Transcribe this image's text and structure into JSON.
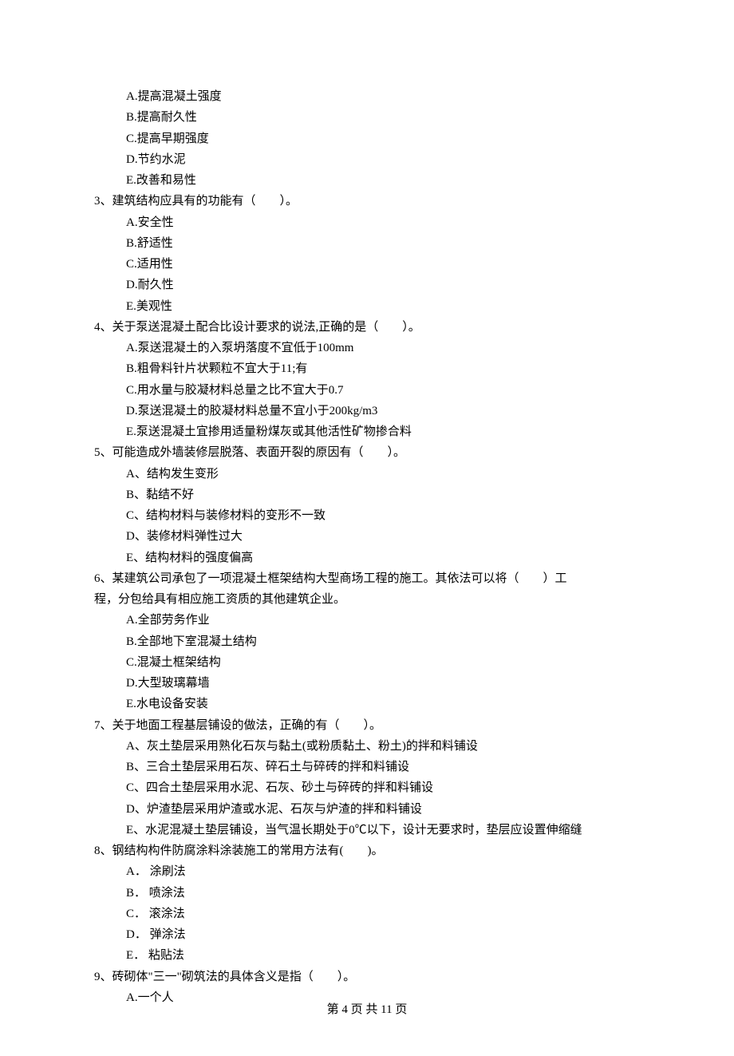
{
  "partialOptions": [
    "A.提高混凝土强度",
    "B.提高耐久性",
    "C.提高早期强度",
    "D.节约水泥",
    "E.改善和易性"
  ],
  "questions": [
    {
      "stem": "3、建筑结构应具有的功能有（　　）。",
      "options": [
        "A.安全性",
        "B.舒适性",
        "C.适用性",
        "D.耐久性",
        "E.美观性"
      ]
    },
    {
      "stem": "4、关于泵送混凝土配合比设计要求的说法,正确的是（　　）。",
      "options": [
        "A.泵送混凝土的入泵坍落度不宜低于100mm",
        "B.粗骨料针片状颗粒不宜大于11;有",
        "C.用水量与胶凝材料总量之比不宜大于0.7",
        "D.泵送混凝土的胶凝材料总量不宜小于200kg/m3",
        "E.泵送混凝土宜掺用适量粉煤灰或其他活性矿物掺合料"
      ]
    },
    {
      "stem": "5、可能造成外墙装修层脱落、表面开裂的原因有（　　）。",
      "options": [
        "A、结构发生变形",
        "B、黏结不好",
        "C、结构材料与装修材料的变形不一致",
        "D、装修材料弹性过大",
        "E、结构材料的强度偏高"
      ]
    },
    {
      "stem": "6、某建筑公司承包了一项混凝土框架结构大型商场工程的施工。其依法可以将（　　）工",
      "stemContinue": "程，分包给具有相应施工资质的其他建筑企业。",
      "options": [
        "A.全部劳务作业",
        "B.全部地下室混凝土结构",
        "C.混凝土框架结构",
        "D.大型玻璃幕墙",
        "E.水电设备安装"
      ]
    },
    {
      "stem": "7、关于地面工程基层铺设的做法，正确的有（　　）。",
      "options": [
        "A、灰土垫层采用熟化石灰与黏土(或粉质黏土、粉土)的拌和料铺设",
        "B、三合土垫层采用石灰、碎石土与碎砖的拌和料铺设",
        "C、四合土垫层采用水泥、石灰、砂土与碎砖的拌和料铺设",
        "D、炉渣垫层采用炉渣或水泥、石灰与炉渣的拌和料铺设",
        "E、水泥混凝土垫层铺设，当气温长期处于0℃以下，设计无要求时，垫层应设置伸缩缝"
      ]
    },
    {
      "stem": "8、钢结构构件防腐涂料涂装施工的常用方法有(　　)。",
      "options": [
        "A． 涂刷法",
        "B． 喷涂法",
        "C． 滚涂法",
        "D． 弹涂法",
        "E． 粘贴法"
      ]
    },
    {
      "stem": "9、砖砌体\"三一\"砌筑法的具体含义是指（　　）。",
      "options": [
        "A.一个人"
      ]
    }
  ],
  "footer": "第 4 页 共 11 页"
}
